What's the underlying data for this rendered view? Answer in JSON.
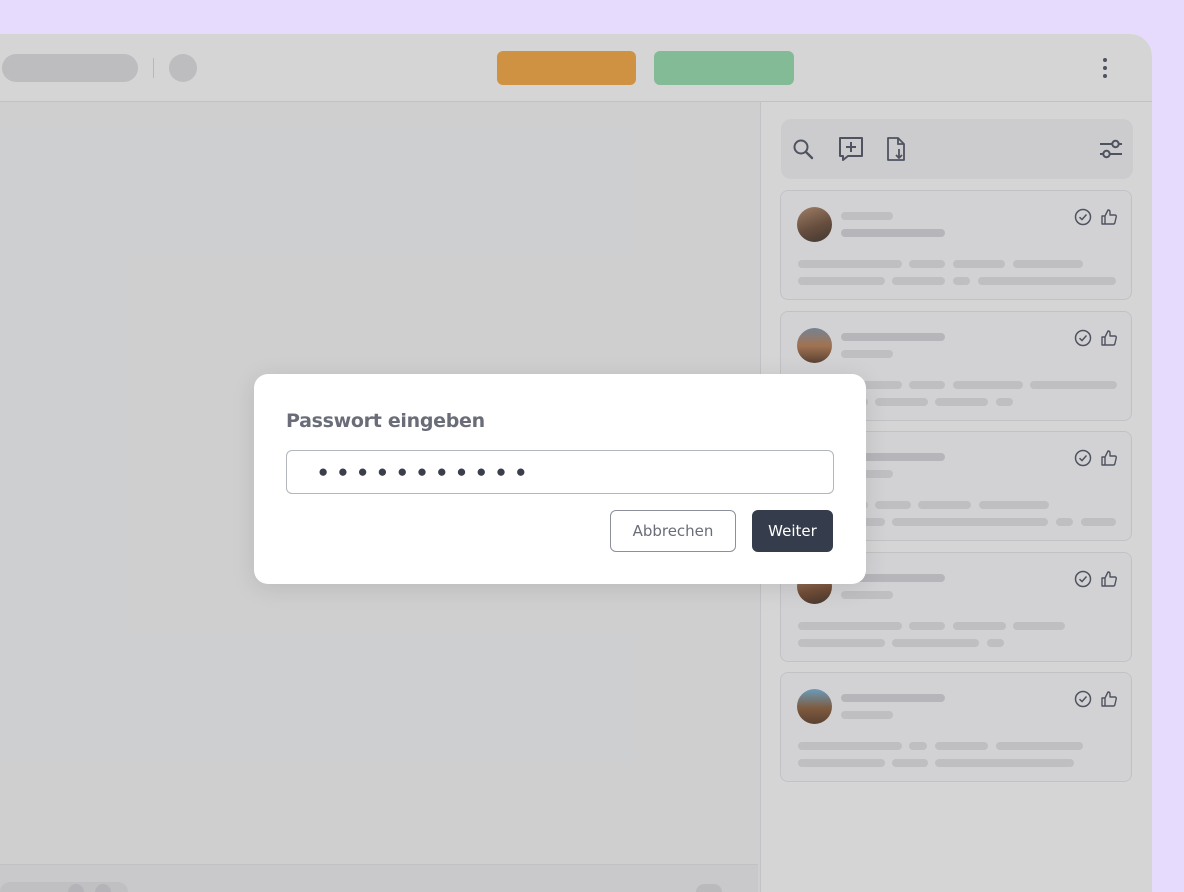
{
  "dialog": {
    "title": "Passwort eingeben",
    "password_value": "●●●●●●●●●●●",
    "cancel_label": "Abbrechen",
    "next_label": "Weiter"
  },
  "toolbar": {
    "icons": [
      "search-icon",
      "add-comment-icon",
      "download-file-icon",
      "filter-settings-icon"
    ]
  },
  "header": {
    "menu_icon": "more-vertical-icon"
  },
  "colors": {
    "background": "#e7dbfd",
    "orange_button": "#f4a43a",
    "green_button": "#8ed9a6",
    "primary_button": "#353c4b"
  },
  "comments": {
    "count": 5,
    "item_icons": [
      "check-circle-icon",
      "thumbs-up-icon"
    ]
  }
}
